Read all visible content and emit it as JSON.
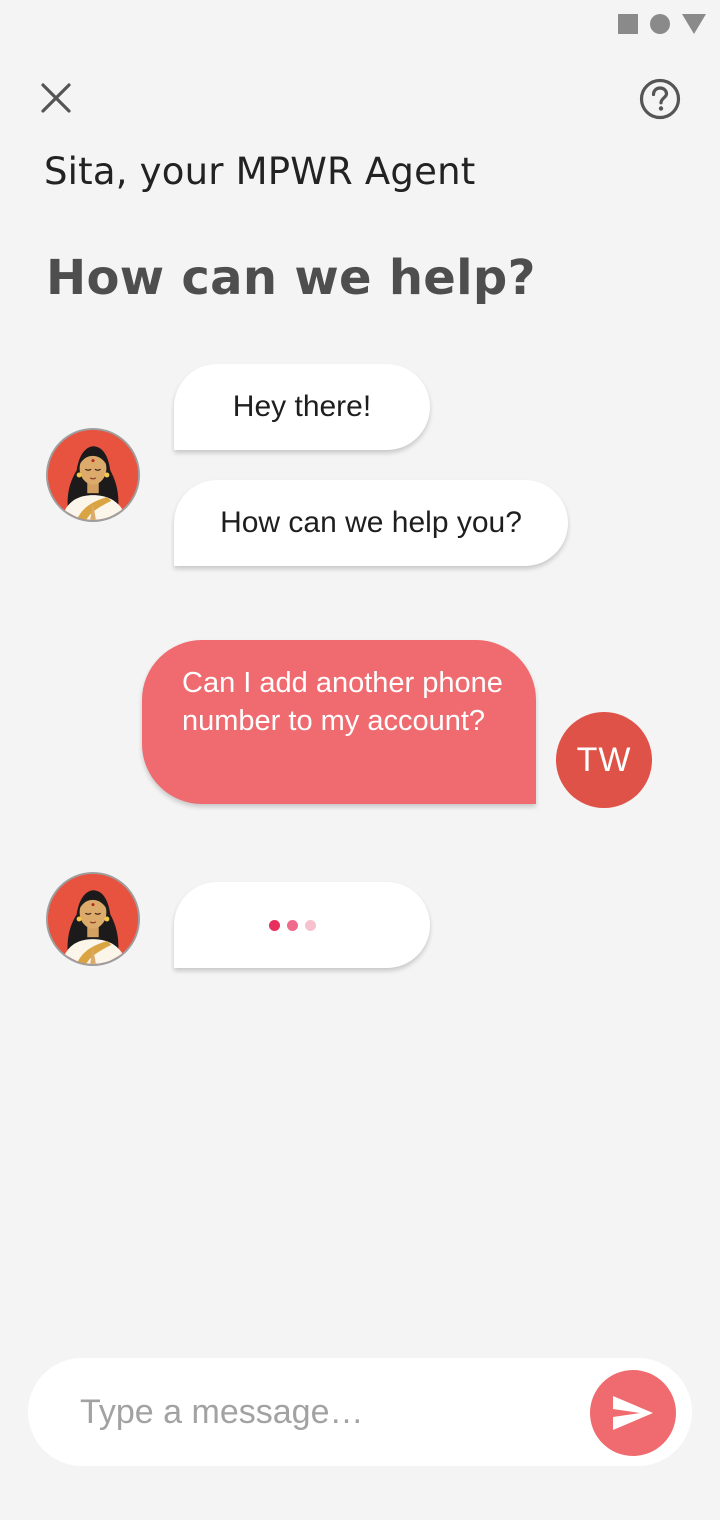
{
  "status_bar": {
    "icons": [
      "square-icon",
      "circle-icon",
      "triangle-icon"
    ]
  },
  "header": {
    "close_icon": "close-icon",
    "help_icon": "help-icon",
    "agent_title": "Sita, your MPWR Agent",
    "heading": "How can we help?"
  },
  "conversation": {
    "agent_messages": [
      "Hey there!",
      "How can we help you?"
    ],
    "user_message": "Can I add another phone number to my account?",
    "user_initials": "TW",
    "typing_indicator": true
  },
  "composer": {
    "placeholder": "Type a message…",
    "value": "",
    "send_icon": "send-icon"
  },
  "colors": {
    "background": "#f4f4f4",
    "accent": "#ef6b6f",
    "user_avatar": "#df5247",
    "typing_dots": [
      "#e8305f",
      "#f06a8c",
      "#f7c0cf"
    ]
  }
}
